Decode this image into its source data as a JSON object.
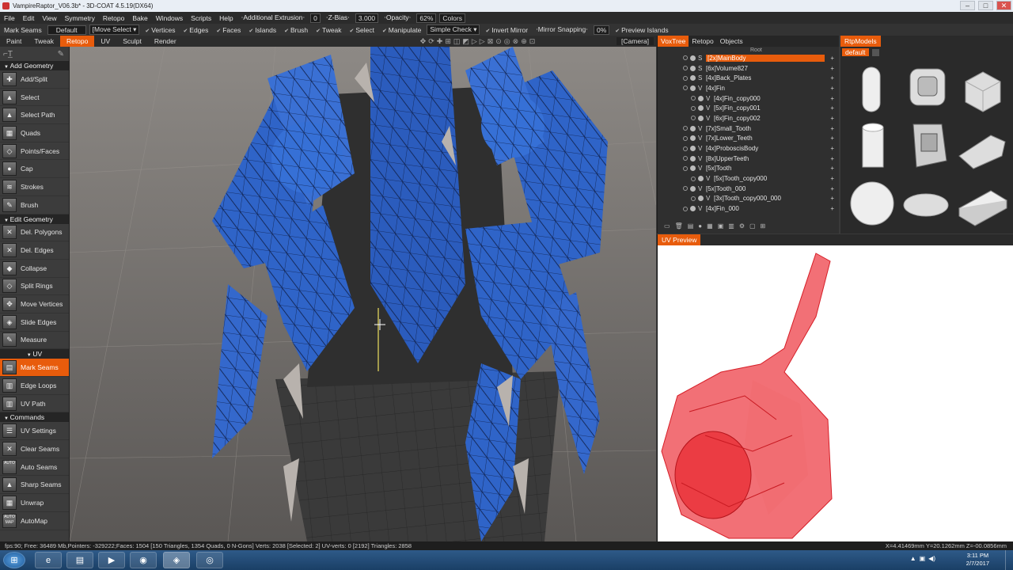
{
  "window": {
    "title": "VampireRaptor_V06.3b* - 3D-COAT 4.5.19(DX64)",
    "minimize": "–",
    "maximize": "□",
    "close": "✕"
  },
  "menu": {
    "items": [
      "File",
      "Edit",
      "View",
      "Symmetry",
      "Retopo",
      "Bake",
      "Windows",
      "Scripts",
      "Help"
    ],
    "extrusion_label": "⋅Additional Extrusion⋅",
    "extrusion_value": "0",
    "zbias_label": "⋅Z-Bias⋅",
    "zbias_value": "3.000",
    "opacity_label": "⋅Opacity⋅",
    "opacity_value": "62%",
    "colors_label": "Colors"
  },
  "toolbar": {
    "mark_seams": "Mark Seams",
    "preset": "Default",
    "move_select": "[Move Select ▾",
    "vertices": "Vertices",
    "edges": "Edges",
    "faces": "Faces",
    "islands": "Islands",
    "brush": "Brush",
    "tweak": "Tweak",
    "select": "Select",
    "manipulate": "Manipulate",
    "simple_check": "Simple Check ▾",
    "invert_mirror": "Invert Mirror",
    "mirror_snapping": "⋅Mirror Snapping⋅",
    "mirror_value": "0%",
    "preview_islands": "Preview Islands"
  },
  "rooms": {
    "tabs": [
      "Paint",
      "Tweak",
      "Retopo",
      "UV",
      "Sculpt",
      "Render"
    ],
    "active": "Retopo",
    "camera": "[Camera]"
  },
  "left_panel": {
    "add_geometry_title": "Add Geometry",
    "add_geometry": [
      {
        "label": "Add/Split",
        "icon": "add-split-icon",
        "glyph": "✚"
      },
      {
        "label": "Select",
        "icon": "select-icon",
        "glyph": "▲"
      },
      {
        "label": "Select Path",
        "icon": "select-path-icon",
        "glyph": "▲"
      },
      {
        "label": "Quads",
        "icon": "quads-icon",
        "glyph": "▦"
      },
      {
        "label": "Points/Faces",
        "icon": "points-faces-icon",
        "glyph": "◇"
      },
      {
        "label": "Cap",
        "icon": "cap-icon",
        "glyph": "●"
      },
      {
        "label": "Strokes",
        "icon": "strokes-icon",
        "glyph": "≋"
      },
      {
        "label": "Brush",
        "icon": "brush-icon",
        "glyph": "✎"
      }
    ],
    "edit_geometry_title": "Edit Geometry",
    "edit_geometry": [
      {
        "label": "Del. Polygons",
        "icon": "delete-polygons-icon",
        "glyph": "✕"
      },
      {
        "label": "Del. Edges",
        "icon": "delete-edges-icon",
        "glyph": "✕"
      },
      {
        "label": "Collapse",
        "icon": "collapse-icon",
        "glyph": "◆"
      },
      {
        "label": "Split Rings",
        "icon": "split-rings-icon",
        "glyph": "◇"
      },
      {
        "label": "Move Vertices",
        "icon": "move-vertices-icon",
        "glyph": "✥"
      },
      {
        "label": "Slide Edges",
        "icon": "slide-edges-icon",
        "glyph": "◈"
      },
      {
        "label": "Measure",
        "icon": "measure-icon",
        "glyph": "✎"
      }
    ],
    "uv_title": "UV",
    "uv": [
      {
        "label": "Mark Seams",
        "icon": "mark-seams-icon",
        "glyph": "▤",
        "active": true
      },
      {
        "label": "Edge Loops",
        "icon": "edge-loops-icon",
        "glyph": "▥"
      },
      {
        "label": "UV Path",
        "icon": "uv-path-icon",
        "glyph": "▥"
      }
    ],
    "commands_title": "Commands",
    "commands": [
      {
        "label": "UV Settings",
        "icon": "uv-settings-icon",
        "glyph": "☰"
      },
      {
        "label": "Clear Seams",
        "icon": "clear-seams-icon",
        "glyph": "✕"
      },
      {
        "label": "Auto Seams",
        "icon": "auto-seams-icon",
        "glyph": "AUTO"
      },
      {
        "label": "Sharp Seams",
        "icon": "sharp-seams-icon",
        "glyph": "▲"
      },
      {
        "label": "Unwrap",
        "icon": "unwrap-icon",
        "glyph": "▦"
      },
      {
        "label": "AutoMap",
        "icon": "automap-icon",
        "glyph": "AUTO MAP"
      }
    ]
  },
  "vox_panel": {
    "tabs": [
      "VoxTree",
      "Retopo",
      "Objects"
    ],
    "active_tab": "VoxTree",
    "root": "Root",
    "layers": [
      {
        "kind": "S",
        "name": "[2x]MainBody",
        "selected": true
      },
      {
        "kind": "S",
        "name": "[6x]Volume827"
      },
      {
        "kind": "S",
        "name": "[4x]Back_Plates"
      },
      {
        "kind": "V",
        "name": "[4x]Fin"
      },
      {
        "kind": "V",
        "name": "[4x]Fin_copy000"
      },
      {
        "kind": "V",
        "name": "[5x]Fin_copy001"
      },
      {
        "kind": "V",
        "name": "[6x]Fin_copy002"
      },
      {
        "kind": "V",
        "name": "[7x]Small_Tooth"
      },
      {
        "kind": "V",
        "name": "[7x]Lower_Teeth"
      },
      {
        "kind": "V",
        "name": "[4x]ProboscisBody"
      },
      {
        "kind": "V",
        "name": "[8x]UpperTeeth"
      },
      {
        "kind": "V",
        "name": "[5x]Tooth"
      },
      {
        "kind": "V",
        "name": "[5x]Tooth_copy000"
      },
      {
        "kind": "V",
        "name": "[5x]Tooth_000"
      },
      {
        "kind": "V",
        "name": "[3x]Tooth_copy000_000"
      },
      {
        "kind": "V",
        "name": "[4x]Fin_000"
      }
    ],
    "add_symbol": "+"
  },
  "models_panel": {
    "tab": "RtpModels",
    "preset": "default",
    "models": [
      "capsule",
      "rounded-block",
      "cube",
      "cylinder",
      "bolt-block",
      "wedge-block",
      "sphere",
      "disc",
      "lego-brick"
    ]
  },
  "uv_preview": {
    "title": "UV Preview"
  },
  "status": {
    "text": "fps:90;   Free: 36489 Mb,Pointers: -329222;Faces: 1504  [150 Triangles, 1354 Quads, 0 N-Gons]  Verts: 2038  [Selected: 2]  UV-verts: 0  [2192]  Triangles: 2858",
    "coords": "X=4.41469mm  Y=20.1262mm  Z=-00.0856mm"
  },
  "taskbar": {
    "time": "3:11 PM",
    "date": "2/7/2017"
  },
  "colors": {
    "accent": "#e85c0c",
    "mesh_blue": "#2f64c8",
    "uv_red": "#e8262e"
  }
}
